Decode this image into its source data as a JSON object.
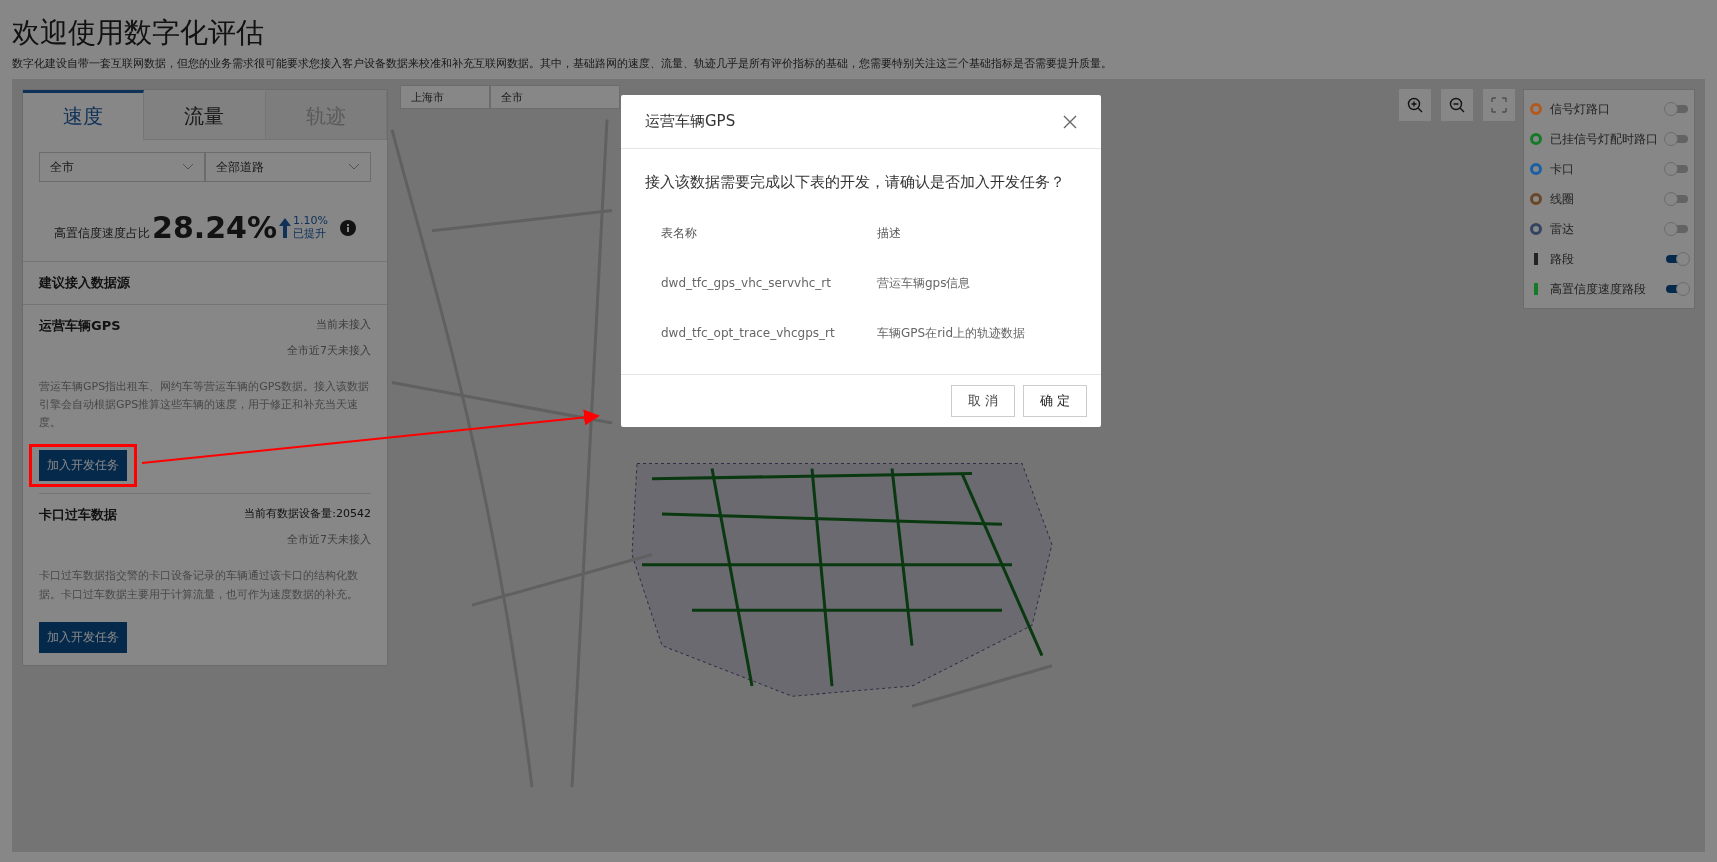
{
  "page": {
    "title": "欢迎使用数字化评估",
    "subtitle": "数字化建设自带一套互联网数据，但您的业务需求很可能要求您接入客户设备数据来校准和补充互联网数据。其中，基础路网的速度、流量、轨迹几乎是所有评价指标的基础，您需要特别关注这三个基础指标是否需要提升质量。"
  },
  "panel": {
    "tabs": [
      {
        "label": "速度",
        "selected": true,
        "disabled": false
      },
      {
        "label": "流量",
        "selected": false,
        "disabled": false
      },
      {
        "label": "轨迹",
        "selected": false,
        "disabled": true
      }
    ],
    "filters": [
      {
        "value": "全市"
      },
      {
        "value": "全部道路"
      }
    ],
    "metric": {
      "label": "高置信度速度占比",
      "value": "28.24%",
      "change": "1.10%",
      "change_note": "已提升"
    },
    "section_title": "建议接入数据源",
    "sources": [
      {
        "name": "运营车辆GPS",
        "status": "当前未接入",
        "connected": false,
        "note": "全市近7天未接入",
        "description": "营运车辆GPS指出租车、网约车等营运车辆的GPS数据。接入该数据引擎会自动根据GPS推算这些车辆的速度，用于修正和补充当天速度。",
        "button": "加入开发任务",
        "highlighted": true
      },
      {
        "name": "卡口过车数据",
        "status": "当前有数据设备量:20542",
        "connected": true,
        "note": "全市近7天未接入",
        "description": "卡口过车数据指交警的卡口设备记录的车辆通过该卡口的结构化数据。卡口过车数据主要用于计算流量，也可作为速度数据的补充。",
        "button": "加入开发任务",
        "highlighted": false
      }
    ]
  },
  "map": {
    "filters": [
      {
        "value": "上海市"
      },
      {
        "value": "全市"
      }
    ],
    "legend": [
      {
        "label": "信号灯路口",
        "kind": "dot",
        "color": "#b3591c",
        "on": false
      },
      {
        "label": "已挂信号灯配时路口",
        "kind": "dot",
        "color": "#157a28",
        "on": false
      },
      {
        "label": "卡口",
        "kind": "dot",
        "color": "#1a5fa6",
        "on": false
      },
      {
        "label": "线圈",
        "kind": "dot",
        "color": "#6b4626",
        "on": false
      },
      {
        "label": "雷达",
        "kind": "dot",
        "color": "#344460",
        "on": false
      },
      {
        "label": "路段",
        "kind": "bar",
        "color": "#222222",
        "on": true
      },
      {
        "label": "高置信度速度路段",
        "kind": "bar",
        "color": "#157a28",
        "on": true
      }
    ]
  },
  "dialog": {
    "title": "运营车辆GPS",
    "message": "接入该数据需要完成以下表的开发，请确认是否加入开发任务？",
    "columns": [
      "表名称",
      "描述"
    ],
    "rows": [
      [
        "dwd_tfc_gps_vhc_servvhc_rt",
        "营运车辆gps信息"
      ],
      [
        "dwd_tfc_opt_trace_vhcgps_rt",
        "车辆GPS在rid上的轨迹数据"
      ]
    ],
    "buttons": [
      {
        "label": "取 消",
        "kind": "cancel"
      },
      {
        "label": "确 定",
        "kind": "ok"
      }
    ]
  }
}
